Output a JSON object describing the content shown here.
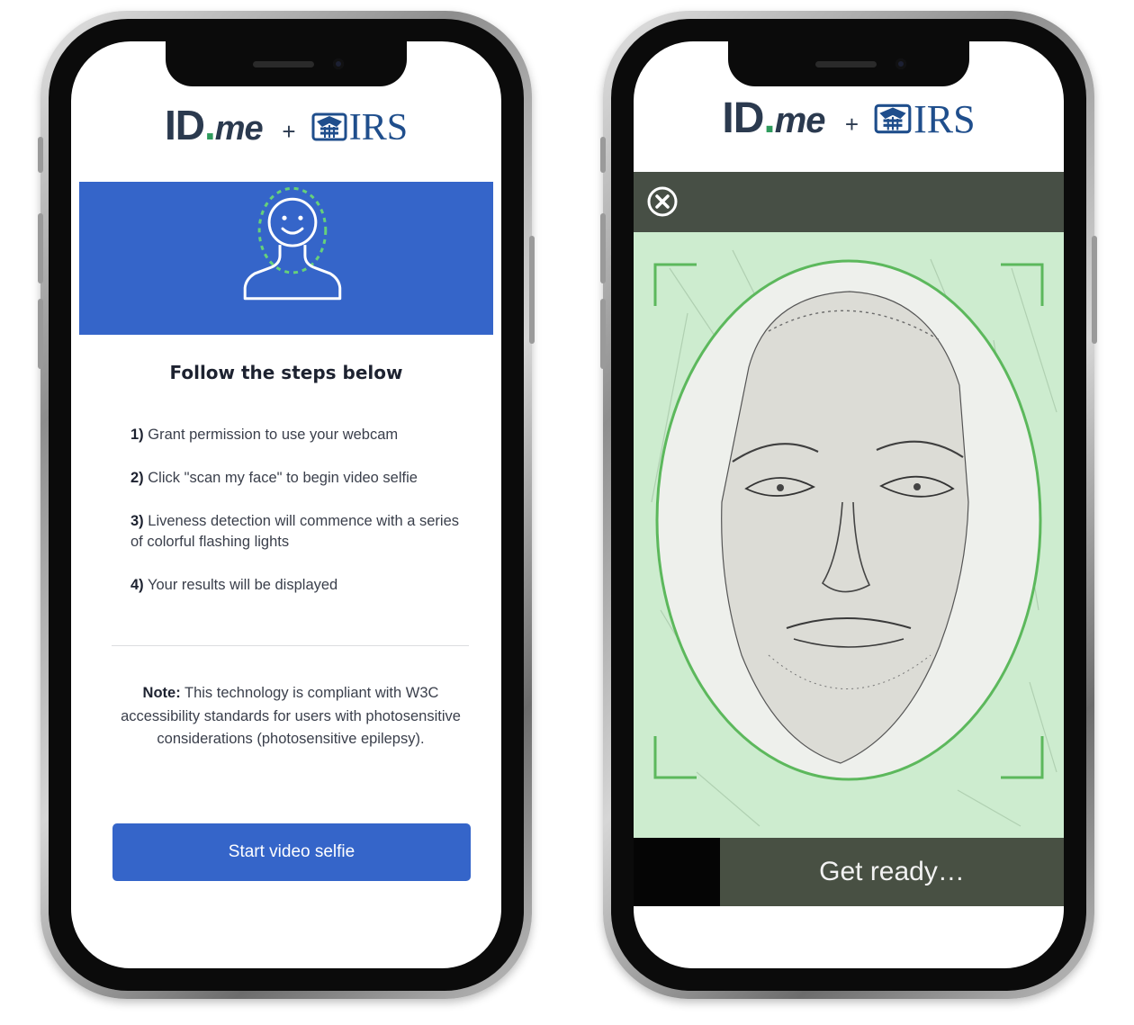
{
  "left_screen": {
    "logo": {
      "idme_id": "ID",
      "idme_dot": ".",
      "idme_me": "me",
      "plus": "+",
      "irs": "IRS"
    },
    "heading": "Follow the steps below",
    "steps": [
      {
        "num": "1)",
        "text": "Grant permission to use your webcam"
      },
      {
        "num": "2)",
        "text": "Click \"scan my face\" to begin video selfie"
      },
      {
        "num": "3)",
        "text": "Liveness detection will commence with a series of colorful flashing lights"
      },
      {
        "num": "4)",
        "text": "Your results will be displayed"
      }
    ],
    "note_label": "Note:",
    "note_text": "This technology is compliant with W3C accessibility standards for users with photosensitive considerations (photosensitive epilepsy).",
    "button_label": "Start video selfie"
  },
  "right_screen": {
    "logo": {
      "idme_id": "ID",
      "idme_dot": ".",
      "idme_me": "me",
      "plus": "+",
      "irs": "IRS"
    },
    "status_text": "Get ready…"
  },
  "colors": {
    "brand_blue": "#3565c9",
    "idme_navy": "#2b3a4f",
    "idme_green": "#2f9b5d",
    "irs_blue": "#1f4e8c",
    "camera_bar": "#474f45",
    "face_guide_green": "#5cb85c",
    "camera_tint": "#cdeccf"
  },
  "icons": {
    "hero": "face-scan-icon",
    "close": "close-circle-icon",
    "irs_emblem": "irs-eagle-icon"
  }
}
